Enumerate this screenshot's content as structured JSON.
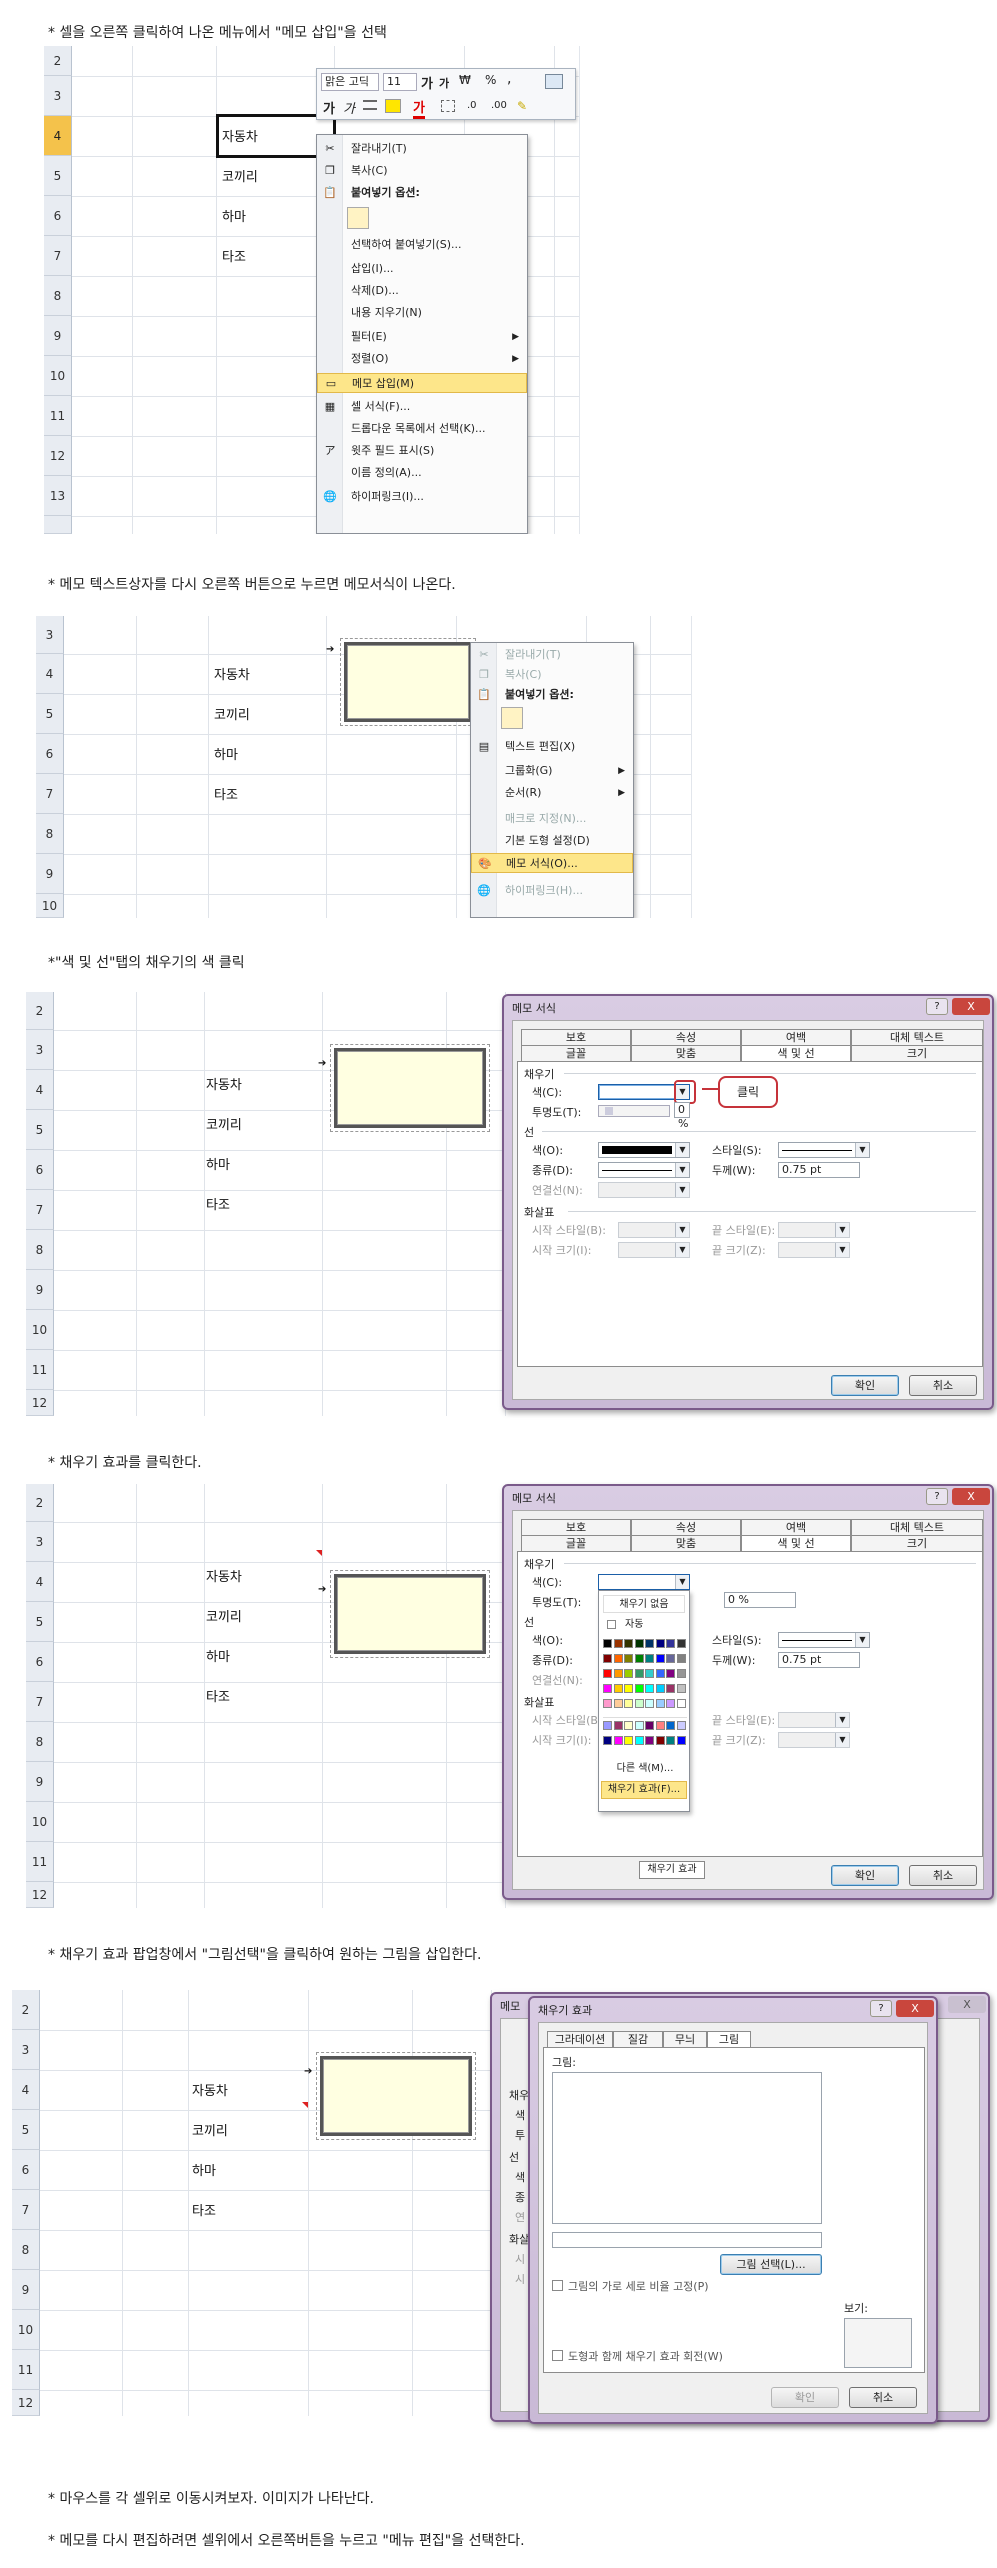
{
  "captions": [
    "* 셀을 오른쪽 클릭하여 나온 메뉴에서 \"메모 삽입\"을 선택",
    "* 메모 텍스트상자를 다시 오른쪽 버튼으로 누르면 메모서식이 나온다.",
    "*\"색 및 선\"탭의 채우기의  색 클릭",
    "* 채우기 효과를 클릭한다.",
    "* 채우기 효과 팝업창에서 \"그림선택\"을 클릭하여 원하는 그림을 삽입한다.",
    "* 마우스를 각 셀위로 이동시켜보자. 이미지가 나타난다.",
    "* 메모를 다시 편집하려면  셀위에서 오른쪽버튼을 누르고 \"메뉴 편집\"을 선택한다."
  ],
  "cells": [
    "자동차",
    "코끼리",
    "하마",
    "타조"
  ],
  "sheet1": {
    "rows": [
      "2",
      "3",
      "4",
      "5",
      "6",
      "7",
      "8",
      "9",
      "10",
      "11",
      "12",
      "13"
    ],
    "selected_row": "4",
    "mini_toolbar": {
      "font": "맑은 고딕",
      "size": "11",
      "grow": "가",
      "shrink": "가",
      "currency": "₩",
      "percent": "%",
      "comma": ",",
      "bold": "가",
      "italic": "가",
      "font_color": "가"
    },
    "menu": [
      {
        "label": "잘라내기(T)",
        "icon": "scissors-icon"
      },
      {
        "label": "복사(C)",
        "icon": "copy-icon"
      },
      {
        "label": "붙여넣기 옵션:",
        "icon": "paste-icon",
        "bold": true
      },
      {
        "label": "",
        "paste_box": true
      },
      {
        "label": "선택하여 붙여넣기(S)..."
      },
      {
        "label": "삽입(I)..."
      },
      {
        "label": "삭제(D)..."
      },
      {
        "label": "내용 지우기(N)"
      },
      {
        "label": "필터(E)",
        "arrow": true
      },
      {
        "label": "정렬(O)",
        "arrow": true
      },
      {
        "label": "메모 삽입(M)",
        "icon": "comment-icon",
        "highlight": true
      },
      {
        "label": "셀 서식(F)...",
        "icon": "format-cells-icon"
      },
      {
        "label": "드롭다운 목록에서 선택(K)..."
      },
      {
        "label": "윗주 필드 표시(S)",
        "icon": "phonetic-icon"
      },
      {
        "label": "이름 정의(A)..."
      },
      {
        "label": "하이퍼링크(I)...",
        "icon": "hyperlink-icon"
      }
    ]
  },
  "sheet2": {
    "rows": [
      "3",
      "4",
      "5",
      "6",
      "7",
      "8",
      "9",
      "10"
    ],
    "menu": [
      {
        "label": "잘라내기(T)",
        "icon": "scissors-icon",
        "disabled": true
      },
      {
        "label": "복사(C)",
        "icon": "copy-icon",
        "disabled": true
      },
      {
        "label": "붙여넣기 옵션:",
        "icon": "paste-icon",
        "bold": true
      },
      {
        "label": "",
        "paste_box": true
      },
      {
        "label": "텍스트 편집(X)",
        "icon": "edit-text-icon"
      },
      {
        "label": "그룹화(G)",
        "arrow": true
      },
      {
        "label": "순서(R)",
        "arrow": true
      },
      {
        "label": "매크로 지정(N)...",
        "disabled": true
      },
      {
        "label": "기본 도형 설정(D)"
      },
      {
        "label": "메모 서식(O)...",
        "icon": "format-comment-icon",
        "highlight": true
      },
      {
        "label": "하이퍼링크(H)...",
        "icon": "hyperlink-icon",
        "disabled": true
      }
    ]
  },
  "sheet3": {
    "rows": [
      "2",
      "3",
      "4",
      "5",
      "6",
      "7",
      "8",
      "9",
      "10",
      "11",
      "12"
    ]
  },
  "sheet4": {
    "rows": [
      "2",
      "3",
      "4",
      "5",
      "6",
      "7",
      "8",
      "9",
      "10",
      "11",
      "12"
    ]
  },
  "sheet5": {
    "rows": [
      "2",
      "3",
      "4",
      "5",
      "6",
      "7",
      "8",
      "9",
      "10",
      "11",
      "12"
    ]
  },
  "memo_dialog": {
    "title": "메모 서식",
    "help": "?",
    "close": "X",
    "tabs_row1": [
      "보호",
      "속성",
      "여백",
      "대체 텍스트"
    ],
    "tabs_row2": [
      "글꼴",
      "맞춤",
      "색 및 선",
      "크기"
    ],
    "fill_group": "채우기",
    "color_label": "색(C):",
    "transparency_label": "투명도(T):",
    "transparency_value": "0 %",
    "line_group": "선",
    "line_color": "색(O):",
    "line_style": "스타일(S):",
    "line_dash": "종류(D):",
    "line_weight": "두께(W):",
    "line_weight_value": "0.75 pt",
    "connector": "연결선(N):",
    "arrow_group": "화살표",
    "begin_style": "시작 스타일(B):",
    "end_style": "끝 스타일(E):",
    "begin_size": "시작 크기(I):",
    "end_size": "끝 크기(Z):",
    "ok": "확인",
    "cancel": "취소",
    "callout": "클릭"
  },
  "color_popup": {
    "no_fill": "채우기 없음",
    "auto": "자동",
    "more_colors": "다른 색(M)...",
    "fill_effects": "채우기 효과(F)...",
    "tooltip": "채우기 효과",
    "palette": [
      [
        "#000000",
        "#993300",
        "#333300",
        "#003300",
        "#003366",
        "#000080",
        "#333399",
        "#333333"
      ],
      [
        "#800000",
        "#FF6600",
        "#808000",
        "#008000",
        "#008080",
        "#0000FF",
        "#666699",
        "#808080"
      ],
      [
        "#FF0000",
        "#FF9900",
        "#99CC00",
        "#339966",
        "#33CCCC",
        "#3366FF",
        "#800080",
        "#969696"
      ],
      [
        "#FF00FF",
        "#FFCC00",
        "#FFFF00",
        "#00FF00",
        "#00FFFF",
        "#00CCFF",
        "#993366",
        "#C0C0C0"
      ],
      [
        "#FF99CC",
        "#FFCC99",
        "#FFFF99",
        "#CCFFCC",
        "#CCFFFF",
        "#99CCFF",
        "#CC99FF",
        "#FFFFFF"
      ]
    ],
    "palette2": [
      [
        "#9999FF",
        "#993366",
        "#FFFFCC",
        "#CCFFFF",
        "#660066",
        "#FF8080",
        "#0066CC",
        "#CCCCFF"
      ],
      [
        "#000080",
        "#FF00FF",
        "#FFFF00",
        "#00FFFF",
        "#800080",
        "#800000",
        "#008080",
        "#0000FF"
      ]
    ]
  },
  "fill_dialog": {
    "title": "채우기 효과",
    "help": "?",
    "close": "X",
    "tabs": [
      "그라데이션",
      "질감",
      "무늬",
      "그림"
    ],
    "picture_label": "그림:",
    "select_btn": "그림 선택(L)...",
    "lock_aspect": "그림의 가로 세로 비율 고정(P)",
    "rotate": "도형과 함께 채우기 효과 회전(W)",
    "sample": "보기:",
    "ok": "확인",
    "cancel": "취소"
  },
  "behind_dialog": {
    "title": "메모",
    "close": "X",
    "fragments": [
      "채우",
      "색",
      "투",
      "선",
      "색",
      "종",
      "연",
      "화살",
      "시",
      "시"
    ]
  }
}
